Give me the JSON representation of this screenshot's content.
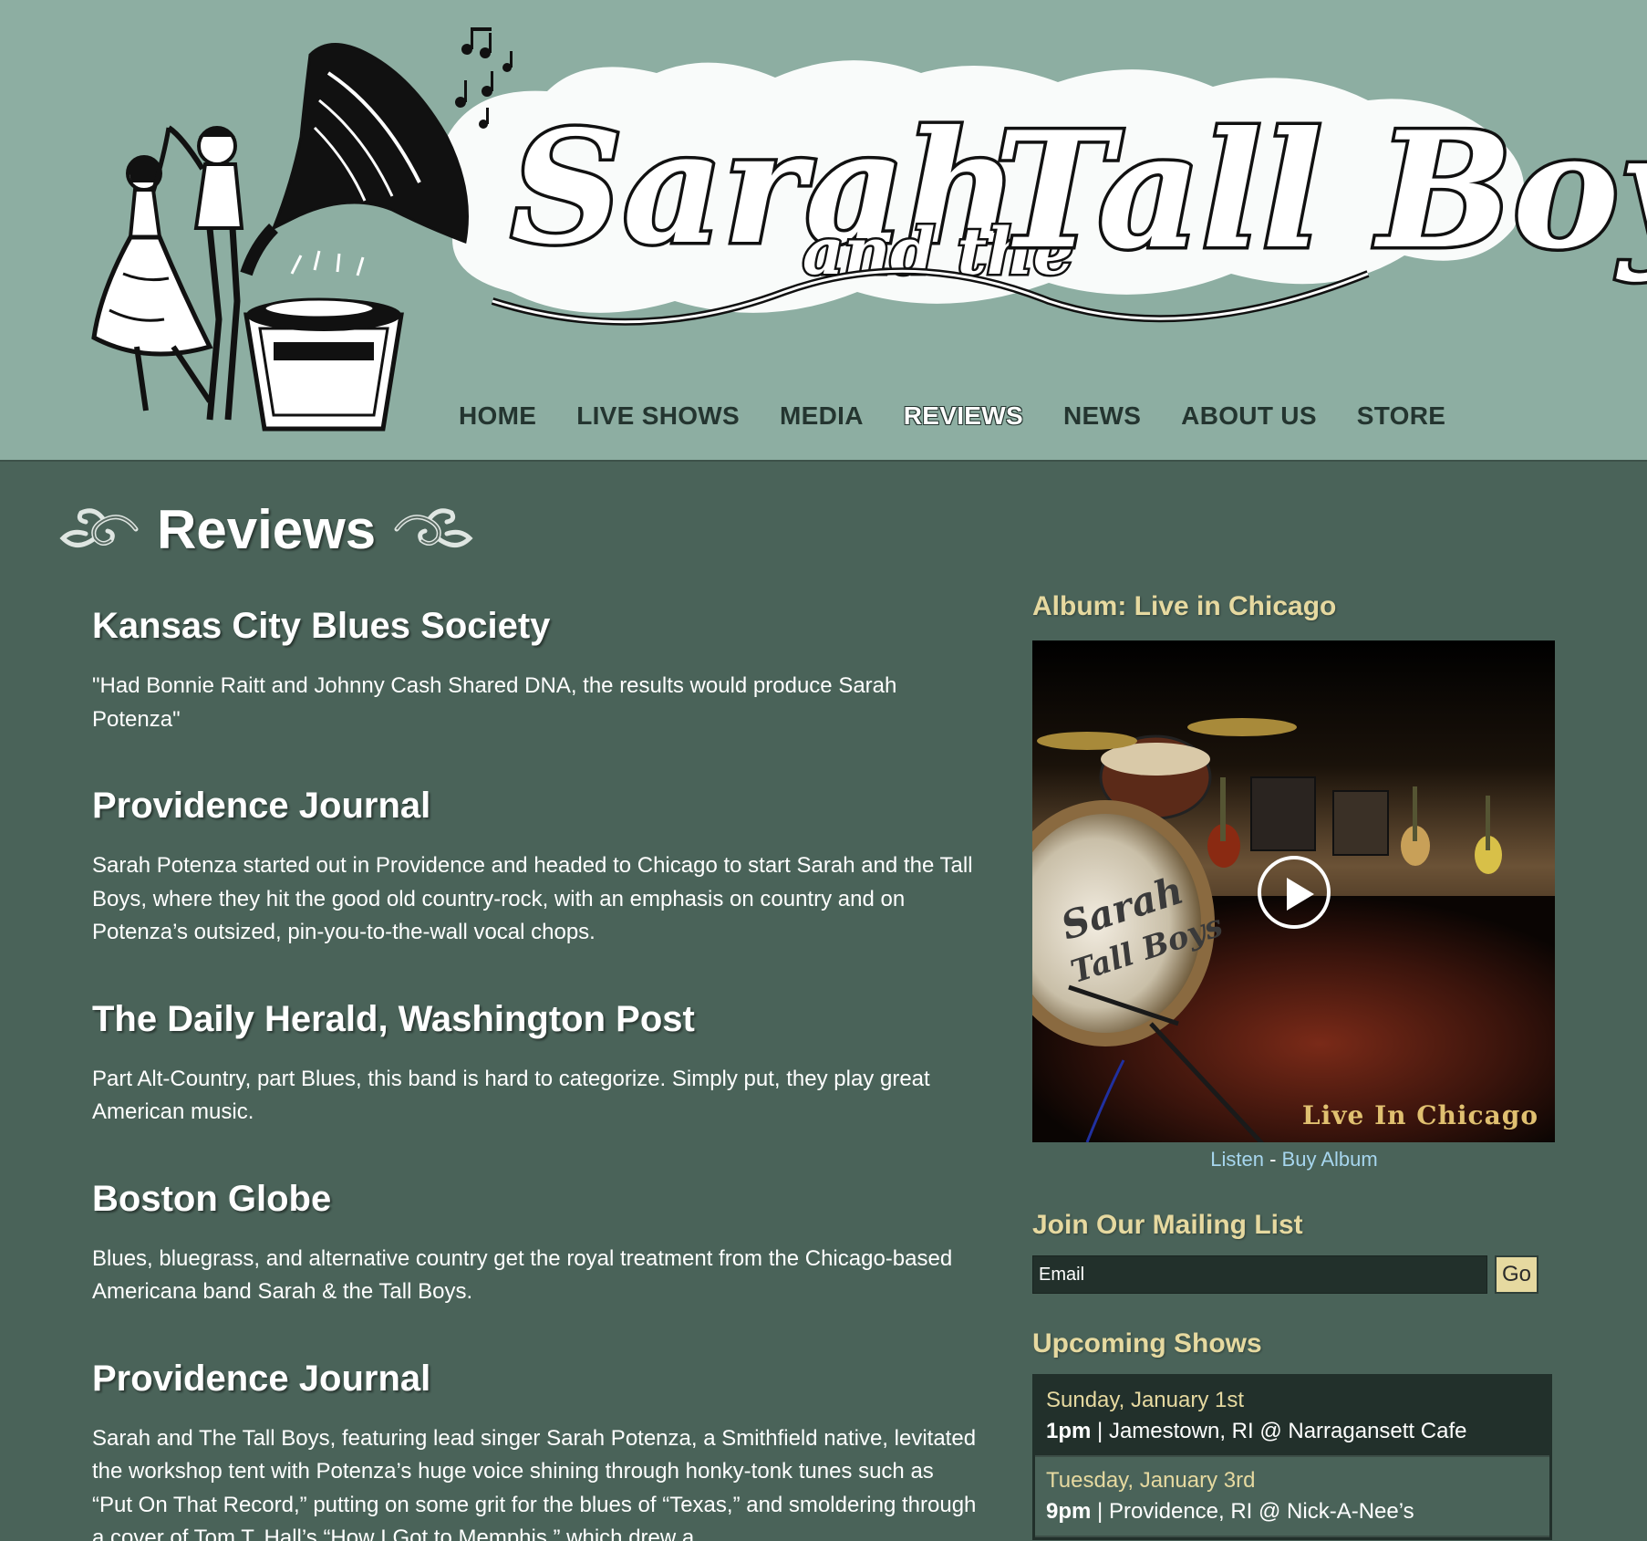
{
  "site": {
    "logo_text": "Sarah and the Tall Boys"
  },
  "nav": {
    "items": [
      {
        "label": "HOME",
        "active": false
      },
      {
        "label": "LIVE SHOWS",
        "active": false
      },
      {
        "label": "MEDIA",
        "active": false
      },
      {
        "label": "REVIEWS",
        "active": true
      },
      {
        "label": "NEWS",
        "active": false
      },
      {
        "label": "ABOUT US",
        "active": false
      },
      {
        "label": "STORE",
        "active": false
      }
    ]
  },
  "page": {
    "title": "Reviews"
  },
  "reviews": [
    {
      "source": "Kansas City Blues Society",
      "text": "\"Had Bonnie Raitt and Johnny Cash Shared DNA, the results would produce Sarah Potenza\""
    },
    {
      "source": "Providence Journal",
      "text": "Sarah Potenza started out in Providence and headed to Chicago to start Sarah and the Tall Boys, where they hit the good old country-rock, with an emphasis on country and on Potenza’s outsized, pin-you-to-the-wall vocal chops."
    },
    {
      "source": "The Daily Herald, Washington Post",
      "text": "Part Alt-Country, part Blues, this band is hard to categorize. Simply put, they play great American music."
    },
    {
      "source": "Boston Globe",
      "text": "Blues, bluegrass, and alternative country get the royal treatment from the Chicago-based Americana band Sarah & the Tall Boys."
    },
    {
      "source": "Providence Journal",
      "text": "Sarah and The Tall Boys, featuring lead singer Sarah Potenza, a Smithfield native, levitated the workshop tent with Potenza’s huge voice shining through honky-tonk tunes such as “Put On That Record,” putting on some grit for the blues of “Texas,” and smoldering through a cover of Tom T. Hall’s “How I Got to Memphis,” which drew a"
    }
  ],
  "sidebar": {
    "album": {
      "heading": "Album: Live in Chicago",
      "cover_caption": "Live In Chicago",
      "listen_label": "Listen",
      "separator": " - ",
      "buy_label": "Buy Album"
    },
    "mailing": {
      "heading": "Join Our Mailing List",
      "email_placeholder": "Email",
      "go_label": "Go"
    },
    "shows": {
      "heading": "Upcoming Shows",
      "items": [
        {
          "date": "Sunday, January 1st",
          "time": "1pm",
          "sep": " | ",
          "details": "Jamestown, RI @ Narragansett Cafe"
        },
        {
          "date": "Tuesday, January 3rd",
          "time": "9pm",
          "sep": " | ",
          "details": "Providence, RI @ Nick-A-Nee’s"
        }
      ]
    }
  },
  "colors": {
    "header_bg": "#8daea2",
    "page_bg": "#4a6359",
    "nav_text": "#243530",
    "accent_gold": "#e6d9a0",
    "link_blue": "#a7d6ee",
    "panel_dark": "#22302b"
  }
}
